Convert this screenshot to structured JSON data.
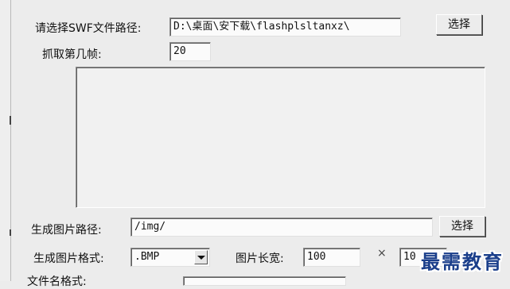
{
  "swf_path": {
    "label": "请选择SWF文件路径:",
    "value": "D:\\桌面\\安下载\\flashplsltanxz\\",
    "button": "选择"
  },
  "frame": {
    "label": "抓取第几帧:",
    "value": "20"
  },
  "output_path": {
    "label": "生成图片路径:",
    "value": "/img/",
    "button": "选择"
  },
  "image_format": {
    "label": "生成图片格式:",
    "selected": ".BMP"
  },
  "image_size": {
    "label": "图片长宽:",
    "width": "100",
    "times": "×",
    "height": "10"
  },
  "next_row": {
    "label": "文件名格式:"
  },
  "watermark": "最需教育"
}
